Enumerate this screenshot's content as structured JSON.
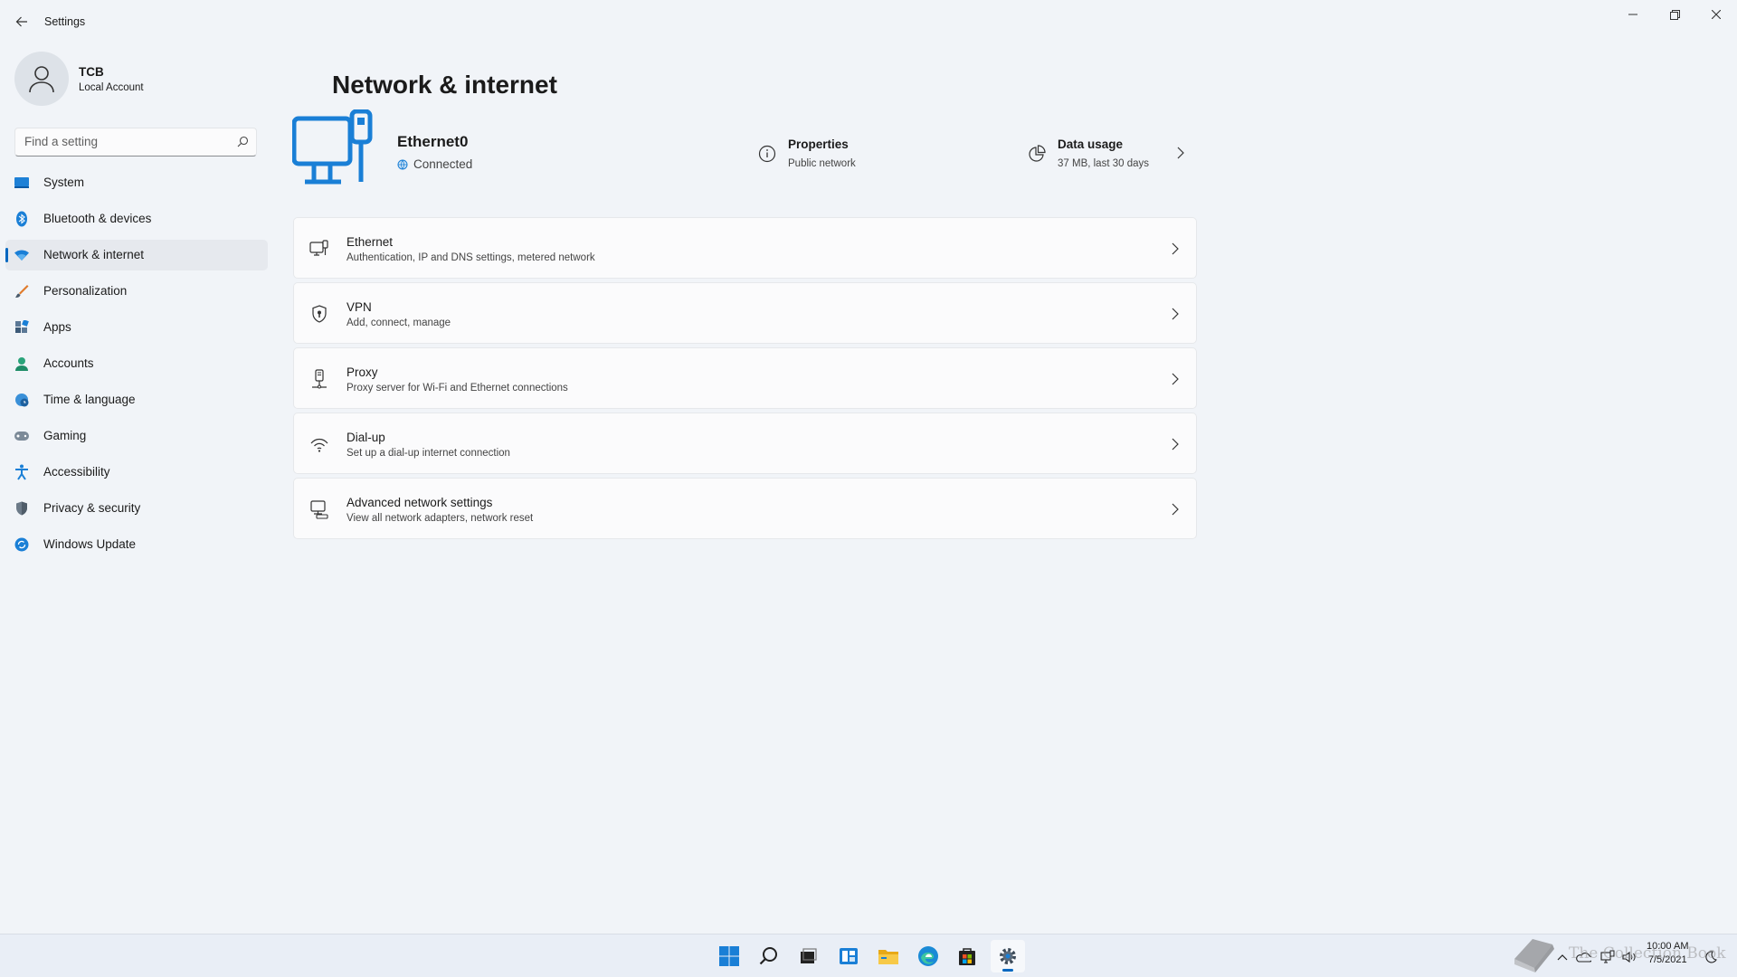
{
  "window": {
    "title": "Settings"
  },
  "profile": {
    "name": "TCB",
    "account_type": "Local Account"
  },
  "search": {
    "placeholder": "Find a setting"
  },
  "sidebar": {
    "items": [
      {
        "label": "System",
        "icon": "monitor-icon"
      },
      {
        "label": "Bluetooth & devices",
        "icon": "bluetooth-icon"
      },
      {
        "label": "Network & internet",
        "icon": "wifi-icon",
        "active": true
      },
      {
        "label": "Personalization",
        "icon": "brush-icon"
      },
      {
        "label": "Apps",
        "icon": "apps-icon"
      },
      {
        "label": "Accounts",
        "icon": "person-icon"
      },
      {
        "label": "Time & language",
        "icon": "globe-clock-icon"
      },
      {
        "label": "Gaming",
        "icon": "gamepad-icon"
      },
      {
        "label": "Accessibility",
        "icon": "accessibility-icon"
      },
      {
        "label": "Privacy & security",
        "icon": "shield-icon"
      },
      {
        "label": "Windows Update",
        "icon": "update-icon"
      }
    ]
  },
  "main": {
    "title": "Network & internet",
    "connection": {
      "name": "Ethernet0",
      "status": "Connected"
    },
    "properties": {
      "title": "Properties",
      "subtitle": "Public network"
    },
    "data_usage": {
      "title": "Data usage",
      "subtitle": "37 MB, last 30 days"
    },
    "cards": [
      {
        "title": "Ethernet",
        "desc": "Authentication, IP and DNS settings, metered network",
        "icon": "ethernet-icon"
      },
      {
        "title": "VPN",
        "desc": "Add, connect, manage",
        "icon": "vpn-shield-icon"
      },
      {
        "title": "Proxy",
        "desc": "Proxy server for Wi-Fi and Ethernet connections",
        "icon": "proxy-icon"
      },
      {
        "title": "Dial-up",
        "desc": "Set up a dial-up internet connection",
        "icon": "dialup-icon"
      },
      {
        "title": "Advanced network settings",
        "desc": "View all network adapters, network reset",
        "icon": "advanced-network-icon"
      }
    ]
  },
  "taskbar": {
    "apps": [
      "start-icon",
      "search-icon",
      "task-view-icon",
      "widgets-icon",
      "file-explorer-icon",
      "edge-icon",
      "store-icon",
      "settings-icon"
    ],
    "time": "10:00 AM",
    "date": "7/5/2021"
  },
  "watermark": {
    "text": "The Collection Book"
  },
  "colors": {
    "accent": "#0067c0",
    "background": "#f1f4f8",
    "card": "#fbfbfc"
  }
}
